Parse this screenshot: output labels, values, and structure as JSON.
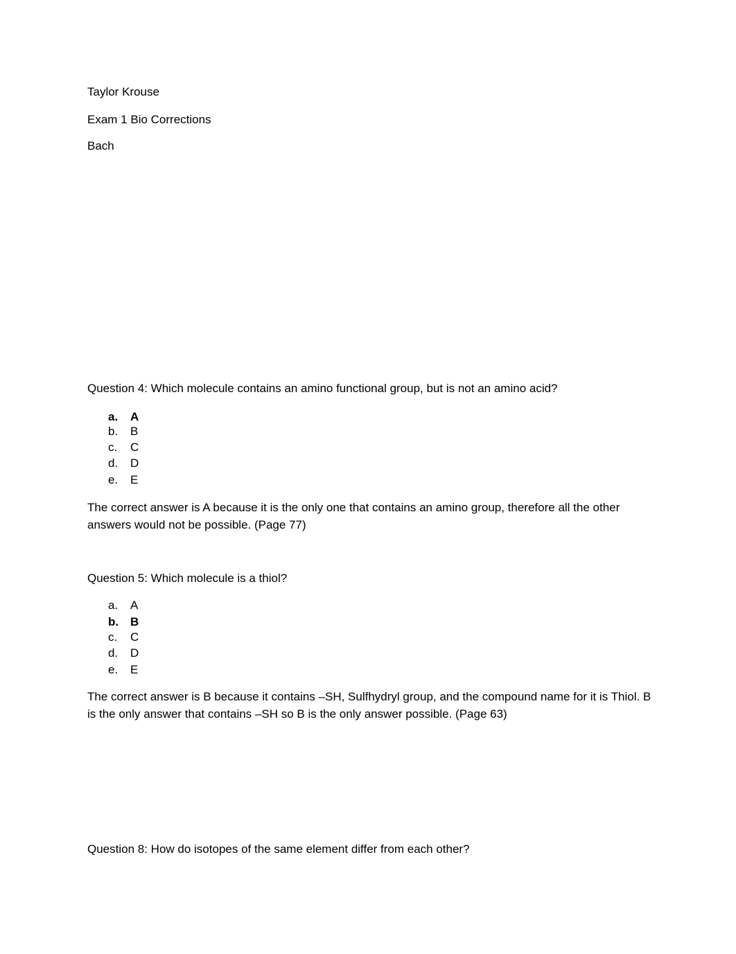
{
  "header": {
    "name": "Taylor Krouse",
    "title": "Exam 1 Bio Corrections",
    "instructor": "Bach"
  },
  "questions": [
    {
      "prompt": "Question 4: Which molecule contains an amino functional group, but is not an amino acid?",
      "options": [
        {
          "label": "a.",
          "text": "A",
          "selected": true
        },
        {
          "label": "b.",
          "text": "B",
          "selected": false
        },
        {
          "label": "c.",
          "text": "C",
          "selected": false
        },
        {
          "label": "d.",
          "text": "D",
          "selected": false
        },
        {
          "label": "e.",
          "text": "E",
          "selected": false
        }
      ],
      "explanation": "The correct answer is A because it is the only one that contains an amino group, therefore all the other answers would not be possible. (Page 77)"
    },
    {
      "prompt": "Question 5: Which molecule is a thiol?",
      "options": [
        {
          "label": "a.",
          "text": "A",
          "selected": false
        },
        {
          "label": "b.",
          "text": "B",
          "selected": true
        },
        {
          "label": "c.",
          "text": "C",
          "selected": false
        },
        {
          "label": "d.",
          "text": "D",
          "selected": false
        },
        {
          "label": "e.",
          "text": "E",
          "selected": false
        }
      ],
      "explanation": "The correct answer is B because it contains –SH, Sulfhydryl group, and the compound name for it is Thiol. B is the only answer that contains –SH so B is the only answer possible. (Page 63)"
    },
    {
      "prompt": "Question 8: How do isotopes of the same element differ from each other?"
    }
  ]
}
